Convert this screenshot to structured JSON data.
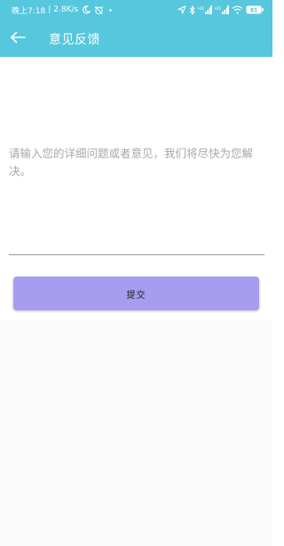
{
  "status_bar": {
    "time": "晚上7:18",
    "separator": "|",
    "speed": "2.8K/s",
    "icons": [
      "moon-icon",
      "alarm-off-icon",
      "dot-icon",
      "location-icon",
      "bluetooth-icon",
      "signal-hd-icon",
      "signal-hd-icon",
      "wifi-icon",
      "battery-icon"
    ],
    "battery_level": "81"
  },
  "app_bar": {
    "back_icon": "arrow-left-icon",
    "title": "意见反馈"
  },
  "feedback": {
    "placeholder": "请输入您的详细问题或者意见，我们将尽快为您解决。"
  },
  "submit": {
    "label": "提交"
  },
  "colors": {
    "header": "#56c7dd",
    "button": "#a69cf0",
    "placeholder": "#a8a8a8",
    "background": "#ffffff"
  }
}
